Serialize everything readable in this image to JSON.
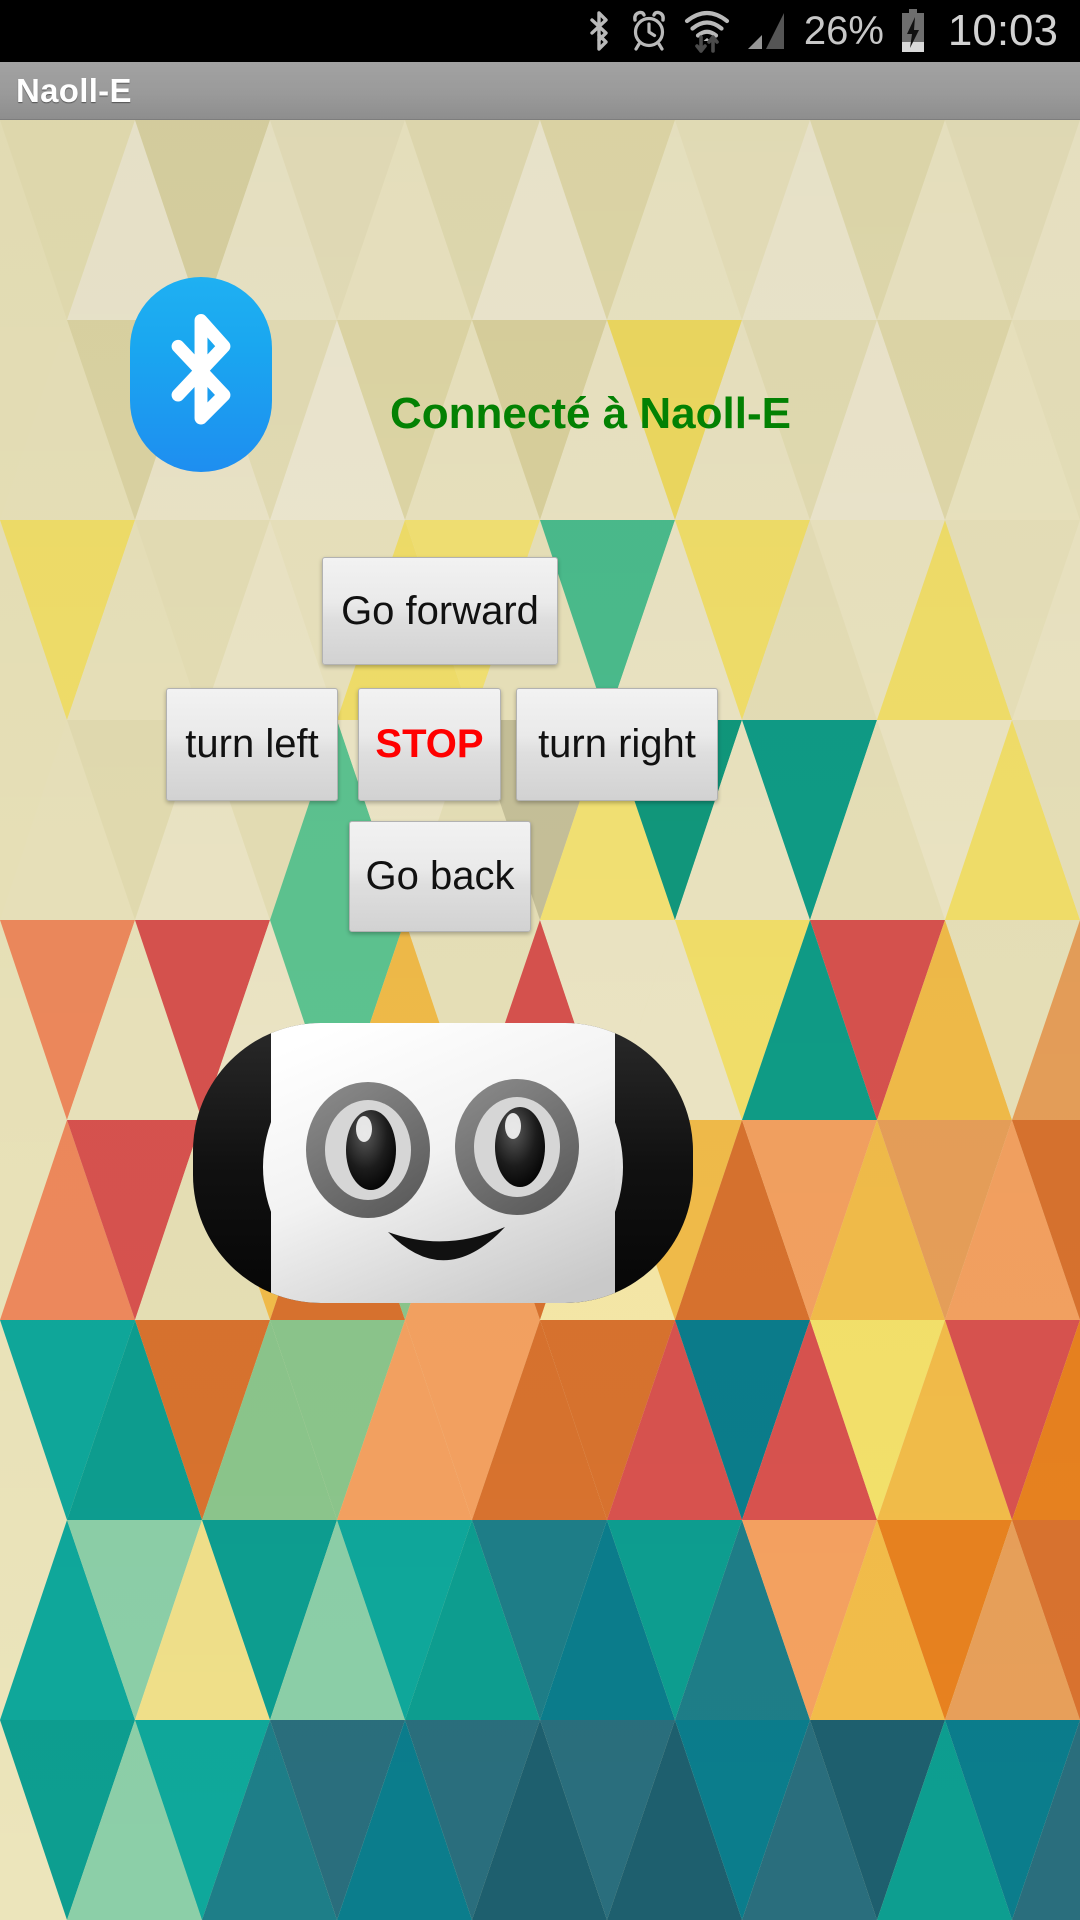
{
  "status_bar": {
    "icons": [
      {
        "name": "bluetooth-icon",
        "label": "Bluetooth"
      },
      {
        "name": "alarm-icon",
        "label": "Alarm set"
      },
      {
        "name": "wifi-icon",
        "label": "Wi-Fi with data transfer"
      },
      {
        "name": "cellular-signal-icon",
        "label": "Cellular signal"
      }
    ],
    "battery_percent": "26%",
    "battery_state": "charging",
    "time": "10:03"
  },
  "action_bar": {
    "title": "Naoll-E"
  },
  "bluetooth_button": {
    "icon": "bluetooth-icon",
    "label": "Bluetooth",
    "color": "#1e9cf0"
  },
  "connection": {
    "status_text": "Connecté à Naoll-E",
    "color": "#038103"
  },
  "controls": {
    "forward_label": "Go forward",
    "left_label": "turn left",
    "stop_label": "STOP",
    "stop_color": "#ff0000",
    "right_label": "turn right",
    "back_label": "Go back"
  },
  "robot": {
    "name": "robot-face-image",
    "description": "Naoll-E robot head with two eyes and a smile"
  }
}
